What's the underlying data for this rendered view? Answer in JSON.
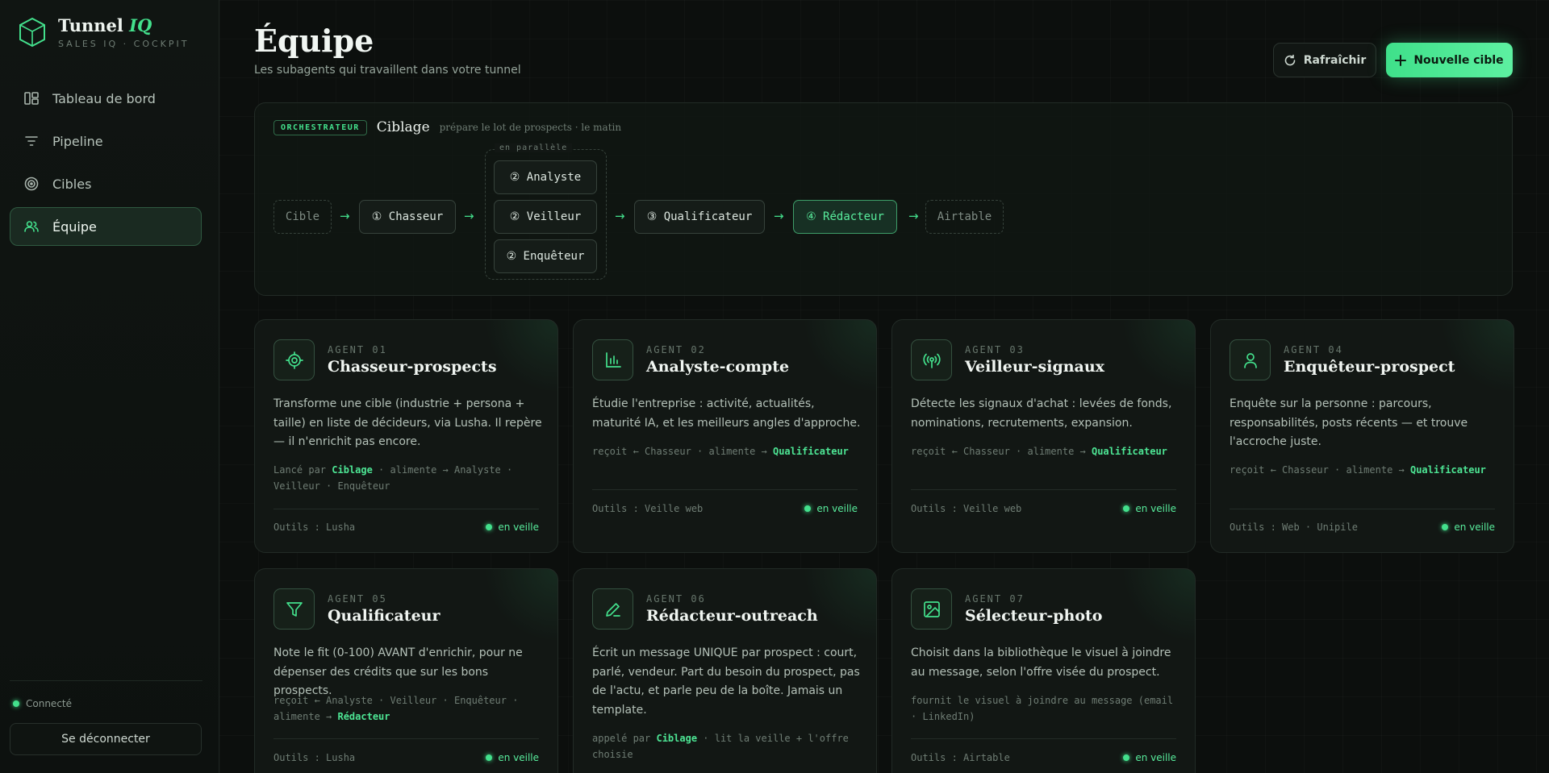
{
  "brand": {
    "name": "Tunnel",
    "name_accent": "IQ",
    "subtitle": "SALES IQ · COCKPIT"
  },
  "nav": [
    {
      "label": "Tableau de bord",
      "icon": "dashboard-icon",
      "active": false
    },
    {
      "label": "Pipeline",
      "icon": "filter-lines-icon",
      "active": false
    },
    {
      "label": "Cibles",
      "icon": "target-icon",
      "active": false
    },
    {
      "label": "Équipe",
      "icon": "users-icon",
      "active": true
    }
  ],
  "status": {
    "label": "Connecté"
  },
  "logout_label": "Se déconnecter",
  "header": {
    "title": "Équipe",
    "subtitle": "Les subagents qui travaillent dans votre tunnel",
    "refresh_label": "Rafraîchir",
    "new_target_label": "Nouvelle cible"
  },
  "orchestrator": {
    "tag": "ORCHESTRATEUR",
    "title": "Ciblage",
    "description": "prépare le lot de prospects · le matin",
    "parallel_label": "en parallèle",
    "nodes": {
      "source": "Cible",
      "chasseur": "① Chasseur",
      "analyste": "② Analyste",
      "veilleur": "② Veilleur",
      "enqueteur": "② Enquêteur",
      "qualificateur": "③ Qualificateur",
      "redacteur": "④ Rédacteur",
      "sink": "Airtable"
    },
    "arrow": "→"
  },
  "agents": [
    {
      "number": "AGENT 01",
      "name": "Chasseur-prospects",
      "icon": "crosshair-icon",
      "description": "Transforme une cible (industrie + persona + taille) en liste de décideurs, via Lusha. Il repère — il n'enrichit pas encore.",
      "flow_pre": "Lancé par ",
      "flow_hl": "Ciblage",
      "flow_post": " · alimente → Analyste · Veilleur · Enquêteur",
      "tools": "Outils : Lusha",
      "state": "en veille"
    },
    {
      "number": "AGENT 02",
      "name": "Analyste-compte",
      "icon": "bar-chart-icon",
      "description": "Étudie l'entreprise : activité, actualités, maturité IA, et les meilleurs angles d'approche.",
      "flow_pre": "reçoit ← Chasseur · alimente → ",
      "flow_hl": "Qualificateur",
      "flow_post": "",
      "tools": "Outils : Veille web",
      "state": "en veille"
    },
    {
      "number": "AGENT 03",
      "name": "Veilleur-signaux",
      "icon": "broadcast-icon",
      "description": "Détecte les signaux d'achat : levées de fonds, nominations, recrutements, expansion.",
      "flow_pre": "reçoit ← Chasseur · alimente → ",
      "flow_hl": "Qualificateur",
      "flow_post": "",
      "tools": "Outils : Veille web",
      "state": "en veille"
    },
    {
      "number": "AGENT 04",
      "name": "Enquêteur-prospect",
      "icon": "person-icon",
      "description": "Enquête sur la personne : parcours, responsabilités, posts récents — et trouve l'accroche juste.",
      "flow_pre": "reçoit ← Chasseur · alimente → ",
      "flow_hl": "Qualificateur",
      "flow_post": "",
      "tools": "Outils : Web · Unipile",
      "state": "en veille"
    },
    {
      "number": "AGENT 05",
      "name": "Qualificateur",
      "icon": "funnel-icon",
      "description": "Note le fit (0-100) AVANT d'enrichir, pour ne dépenser des crédits que sur les bons prospects.",
      "flow_pre": "reçoit ← Analyste · Veilleur · Enquêteur · alimente → ",
      "flow_hl": "Rédacteur",
      "flow_post": "",
      "tools": "Outils : Lusha",
      "state": "en veille"
    },
    {
      "number": "AGENT 06",
      "name": "Rédacteur-outreach",
      "icon": "pencil-icon",
      "description": "Écrit un message UNIQUE par prospect : court, parlé, vendeur. Part du besoin du prospect, pas de l'actu, et parle peu de la boîte. Jamais un template.",
      "flow_pre": "appelé par ",
      "flow_hl": "Ciblage",
      "flow_post": " · lit la veille + l'offre choisie",
      "tools": "",
      "state": ""
    },
    {
      "number": "AGENT 07",
      "name": "Sélecteur-photo",
      "icon": "image-icon",
      "description": "Choisit dans la bibliothèque le visuel à joindre au message, selon l'offre visée du prospect.",
      "flow_pre": "fournit le visuel à joindre au message (email · LinkedIn)",
      "flow_hl": "",
      "flow_post": "",
      "tools": "Outils : Airtable",
      "state": "en veille"
    }
  ],
  "colors": {
    "accent": "#43e08c",
    "background": "#0c0f0d",
    "card": "#121714"
  }
}
